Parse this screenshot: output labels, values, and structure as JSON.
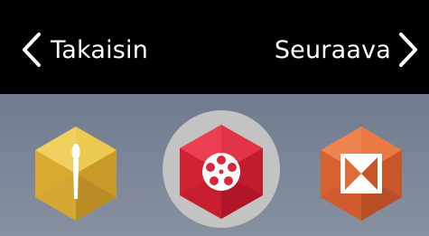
{
  "nav": {
    "back_label": "Takaisin",
    "next_label": "Seuraava",
    "back_icon": "chevron-left-icon",
    "next_icon": "chevron-right-icon"
  },
  "apps": [
    {
      "icon": "paintbrush-icon",
      "color": "#e2b53a",
      "selected": false
    },
    {
      "icon": "film-reel-icon",
      "color": "#d8283a",
      "selected": true
    },
    {
      "icon": "bowtie-frame-icon",
      "color": "#e06a38",
      "selected": false
    }
  ],
  "colors": {
    "topbar": "#000000",
    "tray": "#7a8597",
    "selection_ring": "#c3c3c3",
    "text": "#ffffff"
  }
}
